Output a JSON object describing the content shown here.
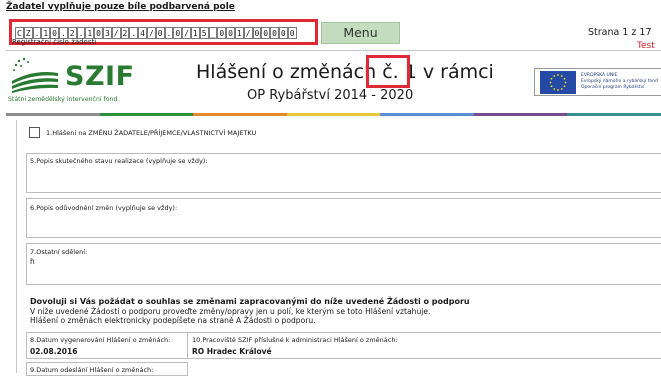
{
  "header": {
    "notice": "Žadatel vyplňuje pouze bíle podbarvená pole",
    "registration_cells": [
      "C",
      "Z",
      ".",
      "1",
      "0",
      ".",
      "2",
      ".",
      "1",
      "0",
      "3",
      "/",
      "2",
      ".",
      "4",
      "/",
      "0",
      ".",
      "0",
      "/",
      "1",
      "5",
      "_",
      "0",
      "0",
      "1",
      "/",
      "0",
      "0",
      "0",
      "0",
      "0"
    ],
    "registration_label": "Registrační číslo žádosti",
    "menu_label": "Menu",
    "page_info": "Strana 1 z 17",
    "test_label": "Test"
  },
  "logo": {
    "name": "SZIF",
    "subtitle": "Státní zemědělský intervenční fond"
  },
  "title": {
    "line1": "Hlášení o změnách č. 1 v rámci",
    "line2": "OP Rybářství 2014 - 2020"
  },
  "eu_badge": {
    "lines": [
      "EVROPSKÁ UNIE",
      "Evropský námořní a rybářský fond",
      "Operační program Rybářství"
    ]
  },
  "colors": {
    "brand_green": "#2a7b32",
    "highlight_red": "#dd2a35",
    "menu_bg": "#c3ddbe",
    "stripe": [
      "#8c8c8c",
      "#2f8f3c",
      "#e48a2a",
      "#e4c73a",
      "#5b8fd0",
      "#7b4a8f",
      "#3a8f8f"
    ]
  },
  "form": {
    "section1_label": "1.Hlášení na ZMĚNU ŽADATELE/PŘÍJEMCE/VLASTNICTVÍ MAJETKU",
    "field5_label": "5.Popis skutečného stavu realizace (vyplňuje se vždy):",
    "field5_value": "",
    "field6_label": "6.Popis odůvodnění změn (vyplňuje se vždy):",
    "field6_value": "",
    "field7_label": "7.Ostatní sdělení:",
    "field7_value": "h",
    "consent_title": "Dovoluji si Vás požádat o souhlas se změnami zapracovanými do níže uvedené Žádosti o podporu",
    "consent_text1": "V níže uvedené Žádosti o podporu proveďte změny/opravy jen u polí, ke kterým se toto Hlášení vztahuje.",
    "consent_text2": "Hlášení o změnách elektronicky podepíšete na straně A Žádosti o podporu.",
    "field8_label": "8.Datum vygenerování Hlášení o změnách:",
    "field8_value": "02.08.2016",
    "field10_label": "10.Pracoviště SZIF příslušné k administraci Hlášení o změnách:",
    "field10_value": "RO Hradec Králové",
    "field9_label": "9.Datum odeslání Hlášení o změnách:",
    "field9_value": ""
  }
}
